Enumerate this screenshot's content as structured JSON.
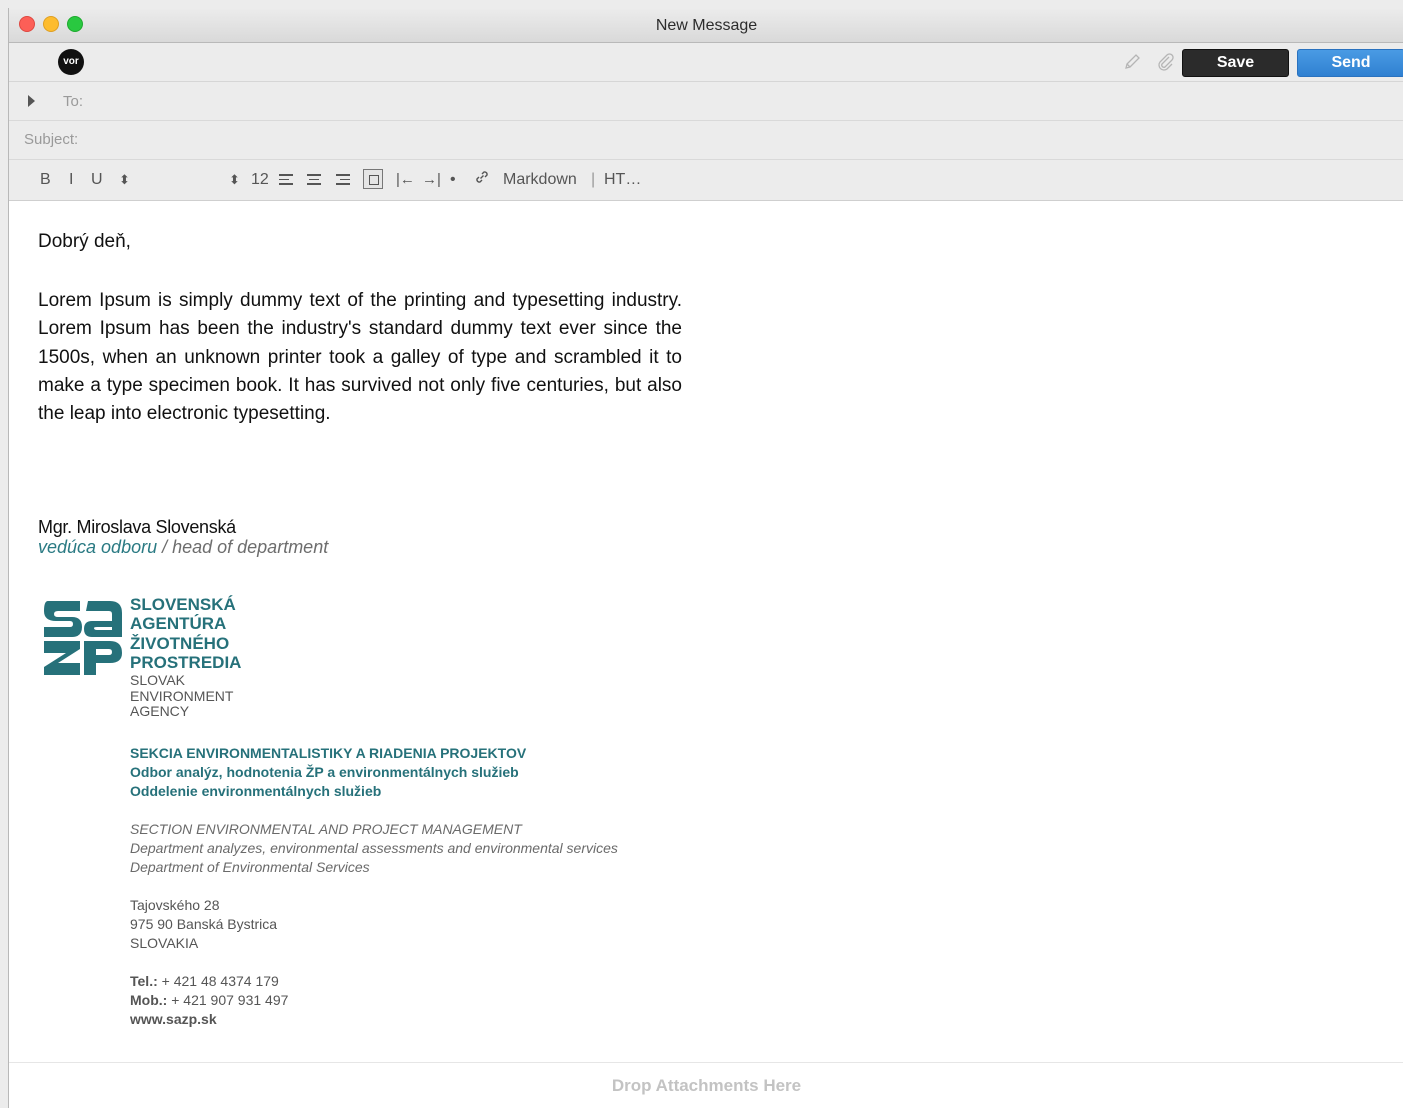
{
  "window": {
    "title": "New Message"
  },
  "toolbar": {
    "avatar_text": "vor",
    "save_label": "Save",
    "send_label": "Send",
    "icons": [
      "pencil-icon",
      "paperclip-icon"
    ]
  },
  "header": {
    "to_label": "To:",
    "subject_label": "Subject:"
  },
  "format_bar": {
    "bold": "B",
    "italic": "I",
    "underline": "U",
    "font_stepper": "⬍",
    "size_stepper": "⬍",
    "font_size": "12",
    "outdent": "|←",
    "indent": "→|",
    "bullet": "•",
    "link": "🔗",
    "markdown": "Markdown",
    "separator": "|",
    "html": "HT…"
  },
  "message": {
    "greeting": "Dobrý deň,",
    "body": "Lorem Ipsum is simply dummy text of the printing and typesetting industry. Lorem Ipsum has been the industry's standard dummy text ever since the 1500s, when an unknown printer took a galley of type and scrambled it to make a type specimen book. It has survived not only five centuries, but also the leap into electronic typesetting."
  },
  "signature": {
    "name": "Mgr. Miroslava Slovenská",
    "role_sk": "vedúca odboru",
    "role_en": " / head of department",
    "agency_sk": [
      "SLOVENSKÁ",
      "AGENTÚRA",
      "ŽIVOTNÉHO",
      "PROSTREDIA"
    ],
    "agency_en": [
      "SLOVAK",
      "ENVIRONMENT",
      "AGENCY"
    ],
    "dept_sk": [
      "SEKCIA ENVIRONMENTALISTIKY A RIADENIA PROJEKTOV",
      "Odbor analýz, hodnotenia ŽP a environmentálnych služieb",
      "Oddelenie environmentálnych služieb"
    ],
    "dept_en": [
      "SECTION ENVIRONMENTAL AND PROJECT MANAGEMENT",
      "Department analyzes, environmental assessments and environmental services",
      "Department of Environmental Services"
    ],
    "address": [
      "Tajovského 28",
      "975 90 Banská Bystrica",
      "SLOVAKIA"
    ],
    "tel_label": "Tel.:",
    "tel": " + 421 48 4374 179",
    "mob_label": "Mob.:",
    "mob": " + 421 907 931 497",
    "web": "www.sazp.sk"
  },
  "drop_zone": {
    "label": "Drop Attachments Here"
  },
  "colors": {
    "accent": "#2f80d1",
    "brand_teal": "#26717a"
  }
}
